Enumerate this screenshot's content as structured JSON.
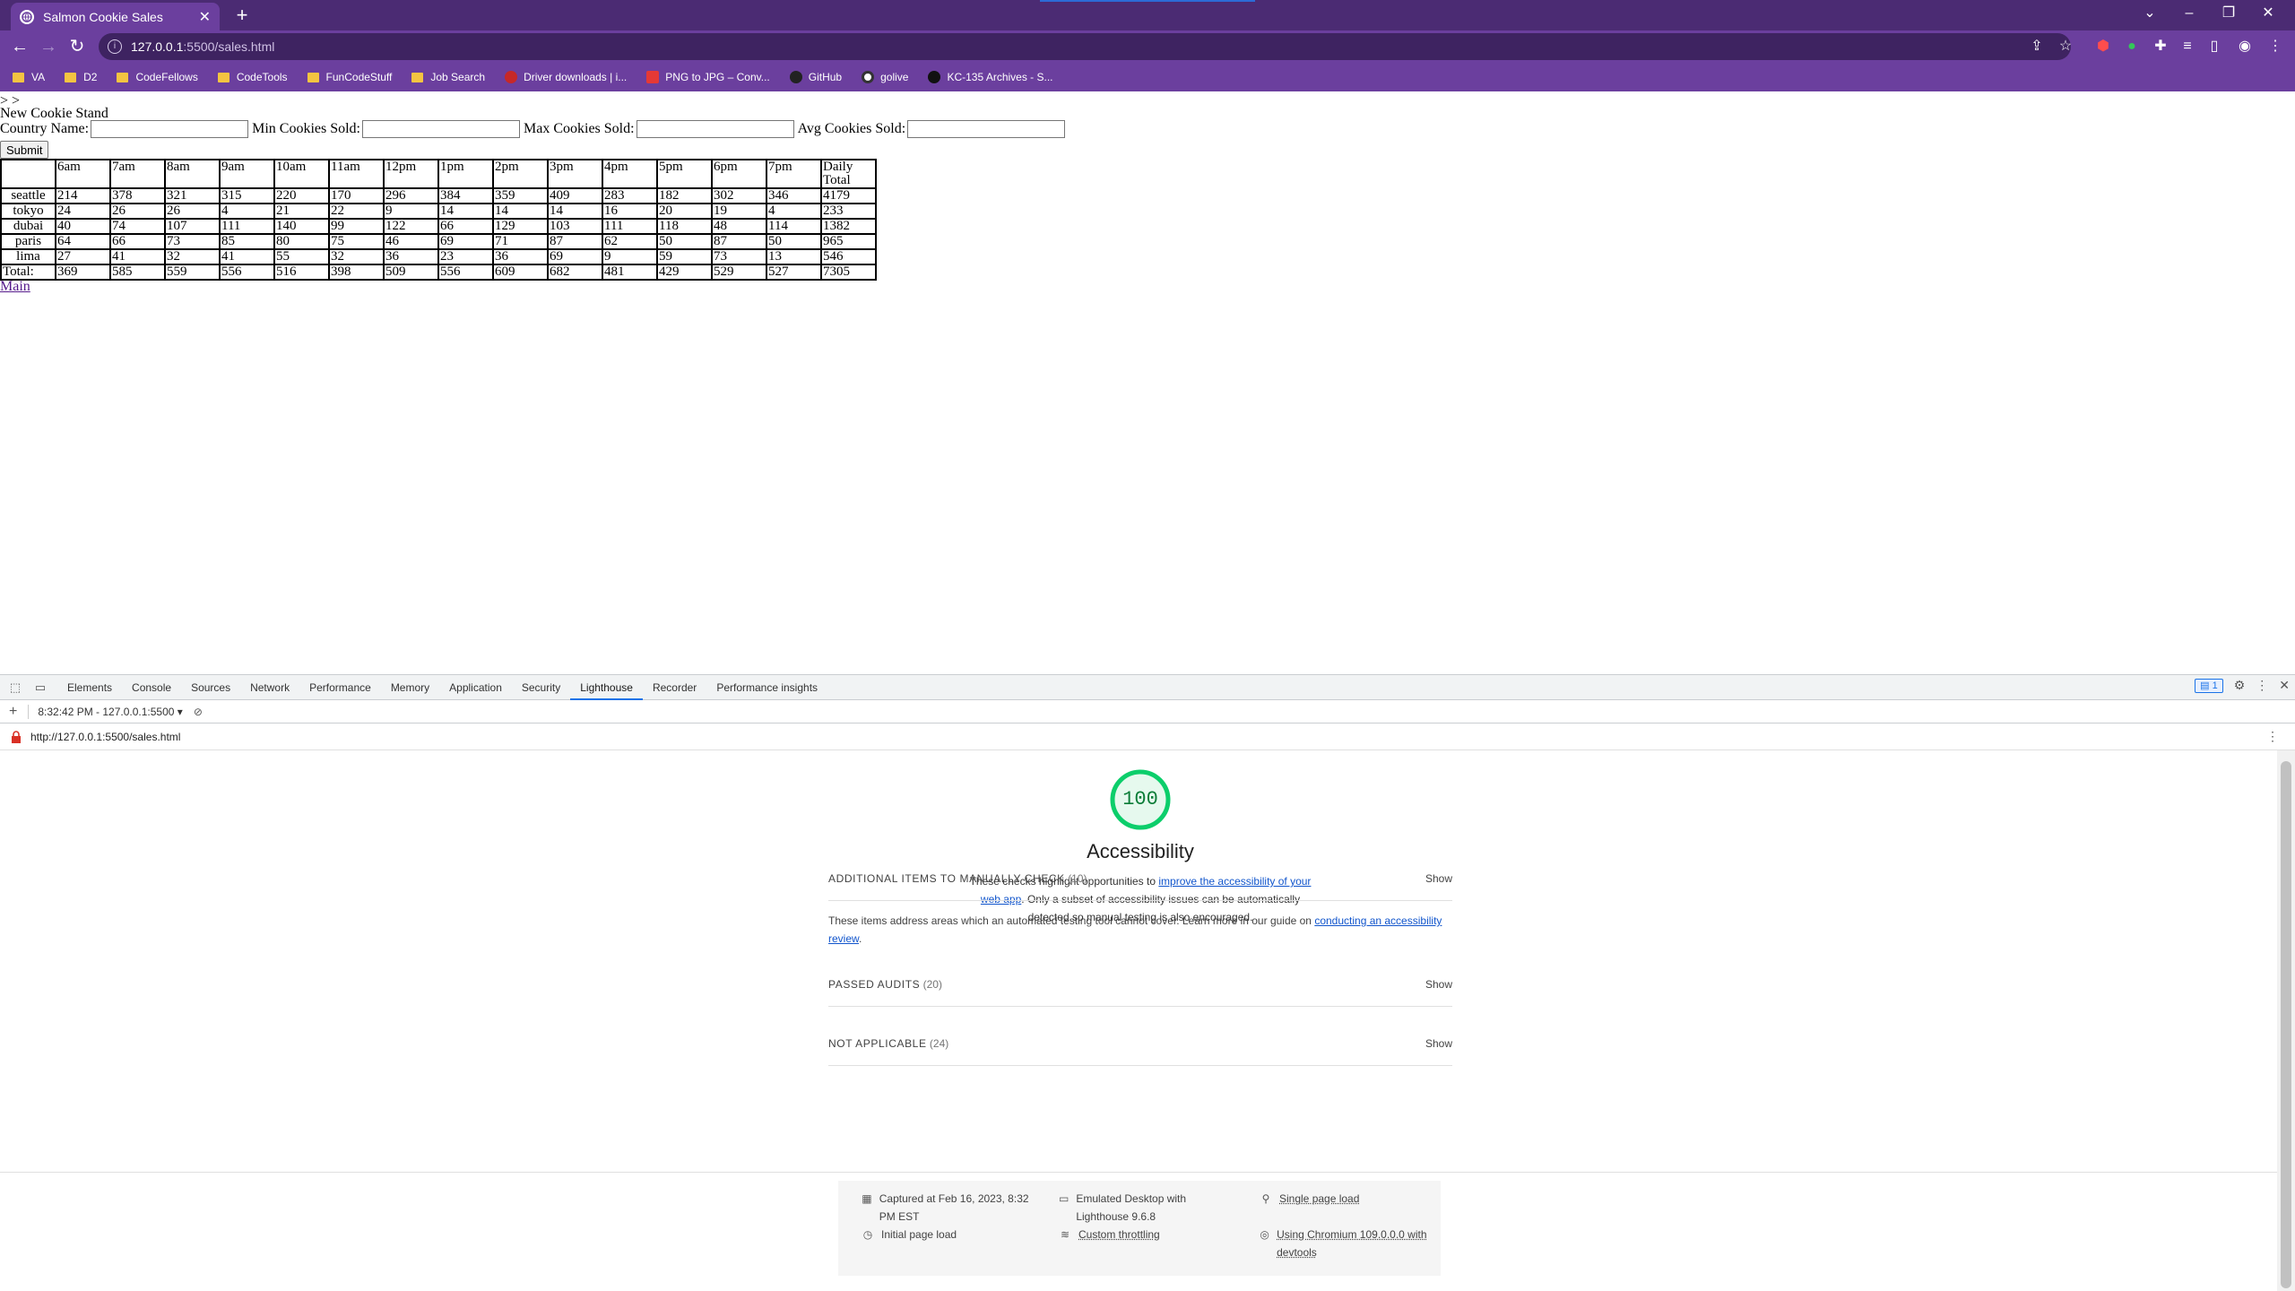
{
  "browser": {
    "tab_title": "Salmon Cookie Sales",
    "url_host": "127.0.0.1",
    "url_path": ":5500/sales.html",
    "bookmarks": [
      {
        "label": "VA",
        "icon": "folder"
      },
      {
        "label": "D2",
        "icon": "folder"
      },
      {
        "label": "CodeFellows",
        "icon": "folder"
      },
      {
        "label": "CodeTools",
        "icon": "folder"
      },
      {
        "label": "FunCodeStuff",
        "icon": "folder"
      },
      {
        "label": "Job Search",
        "icon": "folder"
      },
      {
        "label": "Driver downloads | i...",
        "icon": "site"
      },
      {
        "label": "PNG to JPG – Conv...",
        "icon": "site"
      },
      {
        "label": "GitHub",
        "icon": "github"
      },
      {
        "label": "golive",
        "icon": "site"
      },
      {
        "label": "KC-135 Archives - S...",
        "icon": "site"
      }
    ]
  },
  "page": {
    "arrows": "> >",
    "heading": "New Cookie Stand",
    "form": {
      "country_label": "Country Name:",
      "min_label": "Min Cookies Sold:",
      "max_label": "Max Cookies Sold:",
      "avg_label": "Avg Cookies Sold:",
      "submit_label": "Submit"
    },
    "table": {
      "headers": [
        "6am",
        "7am",
        "8am",
        "9am",
        "10am",
        "11am",
        "12pm",
        "1pm",
        "2pm",
        "3pm",
        "4pm",
        "5pm",
        "6pm",
        "7pm",
        "Daily Total"
      ],
      "rows": [
        {
          "name": "seattle",
          "values": [
            "214",
            "378",
            "321",
            "315",
            "220",
            "170",
            "296",
            "384",
            "359",
            "409",
            "283",
            "182",
            "302",
            "346",
            "4179"
          ]
        },
        {
          "name": "tokyo",
          "values": [
            "24",
            "26",
            "26",
            "4",
            "21",
            "22",
            "9",
            "14",
            "14",
            "14",
            "16",
            "20",
            "19",
            "4",
            "233"
          ]
        },
        {
          "name": "dubai",
          "values": [
            "40",
            "74",
            "107",
            "111",
            "140",
            "99",
            "122",
            "66",
            "129",
            "103",
            "111",
            "118",
            "48",
            "114",
            "1382"
          ]
        },
        {
          "name": "paris",
          "values": [
            "64",
            "66",
            "73",
            "85",
            "80",
            "75",
            "46",
            "69",
            "71",
            "87",
            "62",
            "50",
            "87",
            "50",
            "965"
          ]
        },
        {
          "name": "lima",
          "values": [
            "27",
            "41",
            "32",
            "41",
            "55",
            "32",
            "36",
            "23",
            "36",
            "69",
            "9",
            "59",
            "73",
            "13",
            "546"
          ]
        }
      ],
      "total": {
        "name": "Total:",
        "values": [
          "369",
          "585",
          "559",
          "556",
          "516",
          "398",
          "509",
          "556",
          "609",
          "682",
          "481",
          "429",
          "529",
          "527",
          "7305"
        ]
      }
    },
    "main_link": "Main"
  },
  "devtools": {
    "tabs": [
      "Elements",
      "Console",
      "Sources",
      "Network",
      "Performance",
      "Memory",
      "Application",
      "Security",
      "Lighthouse",
      "Recorder",
      "Performance insights"
    ],
    "active_tab": "Lighthouse",
    "issues_count": "1",
    "report_select": "8:32:42 PM - 127.0.0.1:5500",
    "report_url": "http://127.0.0.1:5500/sales.html",
    "score": "100",
    "score_color": "#0cce6b",
    "category_title": "Accessibility",
    "category_desc_pre": "These checks highlight opportunities to ",
    "category_desc_link": "improve the accessibility of your web app",
    "category_desc_post": ". Only a subset of accessibility issues can be automatically detected so manual testing is also encouraged.",
    "groups": [
      {
        "label": "ADDITIONAL ITEMS TO MANUALLY CHECK",
        "count": "(10)",
        "action": "Show"
      },
      {
        "label": "PASSED AUDITS",
        "count": "(20)",
        "action": "Show"
      },
      {
        "label": "NOT APPLICABLE",
        "count": "(24)",
        "action": "Show"
      }
    ],
    "manual_desc_pre": "These items address areas which an automated testing tool cannot cover. Learn more in our guide on ",
    "manual_desc_link": "conducting an accessibility review",
    "manual_desc_post": ".",
    "footer": {
      "captured": "Captured at Feb 16, 2023, 8:32 PM EST",
      "initial_load": "Initial page load",
      "emulated": "Emulated Desktop with Lighthouse 9.6.8",
      "throttling": "Custom throttling",
      "single_page": "Single page load",
      "chromium": "Using Chromium 109.0.0.0 with devtools"
    }
  }
}
